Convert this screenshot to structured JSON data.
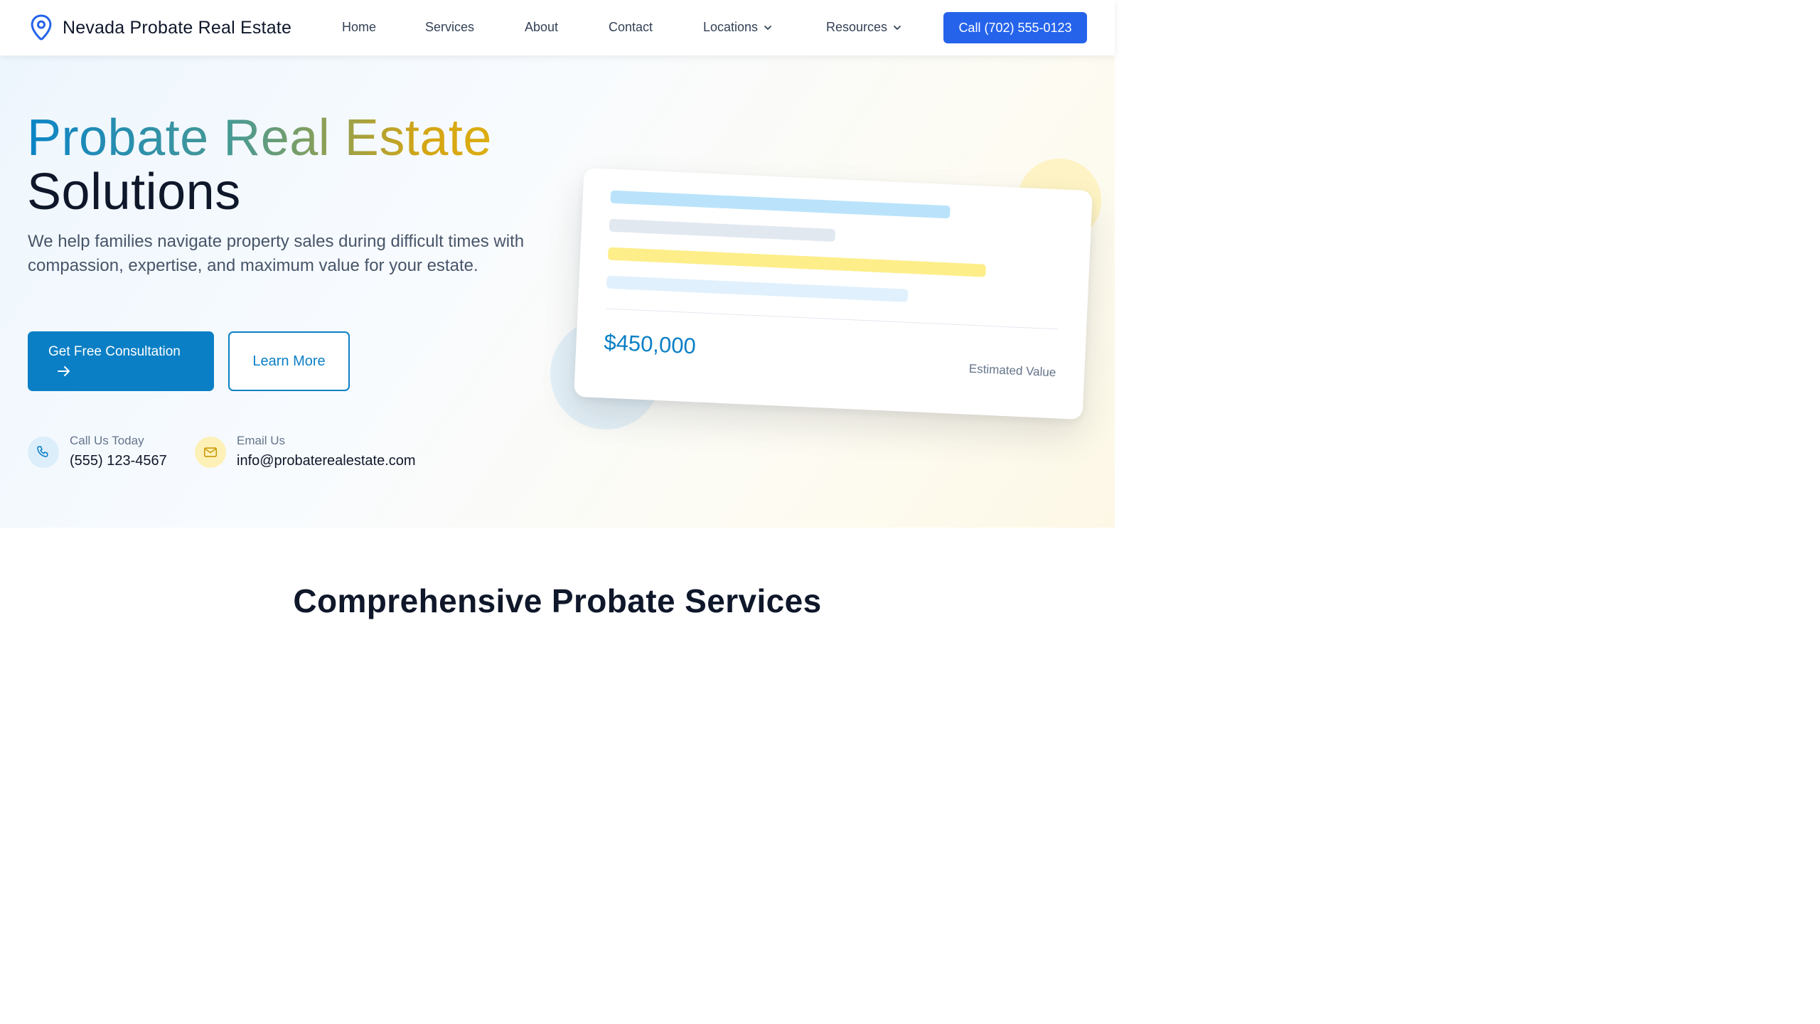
{
  "header": {
    "brand_name": "Nevada Probate Real Estate",
    "nav": {
      "home": "Home",
      "services": "Services",
      "about": "About",
      "contact": "Contact",
      "locations": "Locations",
      "resources": "Resources"
    },
    "call_button": "Call (702) 555-0123"
  },
  "hero": {
    "title_line1_word1": "Probate",
    "title_line1_word2": "Real",
    "title_line1_word3": "Estate",
    "title_line2": "Solutions",
    "description": "We help families navigate property sales during difficult times with compassion, expertise, and maximum value for your estate.",
    "primary_button": "Get Free Consultation",
    "secondary_button": "Learn More",
    "contacts": {
      "phone_label": "Call Us Today",
      "phone_value": "(555) 123-4567",
      "email_label": "Email Us",
      "email_value": "info@probaterealestate.com"
    },
    "card": {
      "price": "$450,000",
      "label": "Estimated Value"
    }
  },
  "services": {
    "title": "Comprehensive Probate Services"
  },
  "colors": {
    "primary_blue": "#0b7fc5",
    "call_button": "#2563eb",
    "gradient_start": "#0b84c6",
    "gradient_end": "#dcae10"
  },
  "icons": [
    "map-pin-icon",
    "chevron-down-icon",
    "arrow-right-icon",
    "phone-icon",
    "mail-icon"
  ]
}
